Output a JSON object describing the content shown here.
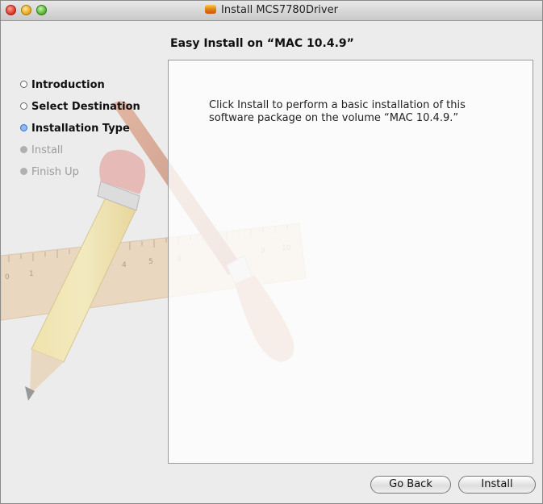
{
  "window": {
    "title": "Install MCS7780Driver",
    "controls": [
      "close",
      "minimize",
      "zoom"
    ]
  },
  "heading": "Easy Install on “MAC 10.4.9”",
  "steps": [
    {
      "label": "Introduction",
      "state": "done"
    },
    {
      "label": "Select Destination",
      "state": "done"
    },
    {
      "label": "Installation Type",
      "state": "current"
    },
    {
      "label": "Install",
      "state": "pending"
    },
    {
      "label": "Finish Up",
      "state": "pending"
    }
  ],
  "body_text": "Click Install to perform a basic installation of this\nsoftware package on the volume “MAC 10.4.9.”",
  "buttons": {
    "go_back": "Go Back",
    "install": "Install"
  },
  "ruler_numbers": [
    "0",
    "1",
    "4",
    "5",
    "0",
    "9",
    "10"
  ],
  "colors": {
    "current_step": "#2d6fd6",
    "pending_step": "#9c9c9c"
  }
}
